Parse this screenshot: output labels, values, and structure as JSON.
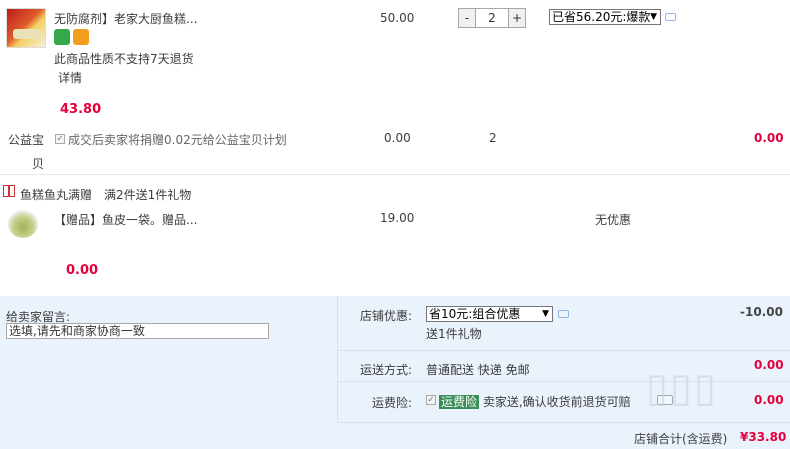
{
  "product": {
    "title": "无防腐剂】老家大厨鱼糕...",
    "return_notice": "此商品性质不支持7天退货",
    "details_link": "详情",
    "price_paid": "43.80",
    "unit_price": "50.00",
    "quantity": "2",
    "qty_minus": "-",
    "qty_plus": "+",
    "promo_option": "已省56.20元:爆款"
  },
  "charity": {
    "label_line1": "公益宝",
    "label_line2": "贝",
    "text": "成交后卖家将捐赠0.02元给公益宝贝计划",
    "price": "0.00",
    "quantity": "2",
    "total": "0.00"
  },
  "gift_promo": {
    "name": "鱼糕鱼丸满赠",
    "rule": "满2件送1件礼物"
  },
  "gift_item": {
    "title": "【赠品】鱼皮一袋。赠品...",
    "price": "19.00",
    "discount": "无优惠",
    "total": "0.00"
  },
  "order_panel": {
    "memo_label": "给卖家留言:",
    "memo_placeholder": "选填,请先和商家协商一致",
    "shop_discount_label": "店铺优惠:",
    "shop_discount_option": "省10元:组合优惠",
    "shop_discount_gift": "送1件礼物",
    "shop_discount_amount": "-10.00",
    "shipping_label": "运送方式:",
    "shipping_text": "普通配送 快递 免邮",
    "shipping_amount": "0.00",
    "insurance_label": "运费险:",
    "insurance_tag": "运费险",
    "insurance_text": "卖家送,确认收货前退货可赔",
    "insurance_amount": "0.00",
    "shop_total_label": "店铺合计(含运费)",
    "shop_total_value": "¥33.80"
  },
  "colors": {
    "accent_red": "#e4003c",
    "panel_bg": "#eaf2fb",
    "insurance_green": "#3a8e57"
  }
}
